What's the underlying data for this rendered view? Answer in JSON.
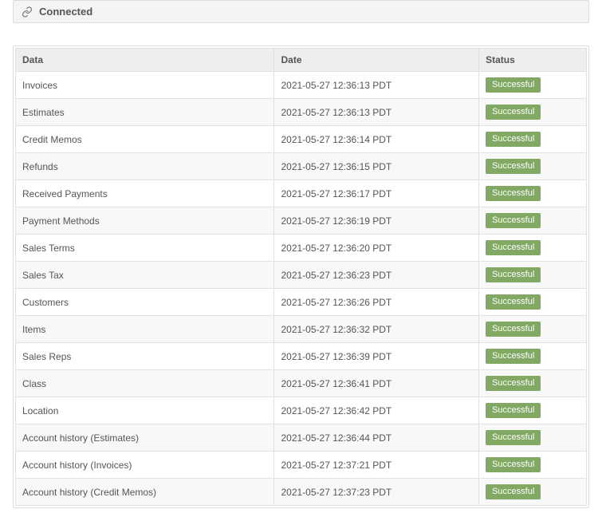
{
  "header": {
    "connected_label": "Connected",
    "icon_name": "link-icon"
  },
  "table": {
    "columns": {
      "data": "Data",
      "date": "Date",
      "status": "Status"
    },
    "status_badge_color": "#82a963",
    "rows": [
      {
        "data": "Invoices",
        "date": "2021-05-27 12:36:13 PDT",
        "status": "Successful"
      },
      {
        "data": "Estimates",
        "date": "2021-05-27 12:36:13 PDT",
        "status": "Successful"
      },
      {
        "data": "Credit Memos",
        "date": "2021-05-27 12:36:14 PDT",
        "status": "Successful"
      },
      {
        "data": "Refunds",
        "date": "2021-05-27 12:36:15 PDT",
        "status": "Successful"
      },
      {
        "data": "Received Payments",
        "date": "2021-05-27 12:36:17 PDT",
        "status": "Successful"
      },
      {
        "data": "Payment Methods",
        "date": "2021-05-27 12:36:19 PDT",
        "status": "Successful"
      },
      {
        "data": "Sales Terms",
        "date": "2021-05-27 12:36:20 PDT",
        "status": "Successful"
      },
      {
        "data": "Sales Tax",
        "date": "2021-05-27 12:36:23 PDT",
        "status": "Successful"
      },
      {
        "data": "Customers",
        "date": "2021-05-27 12:36:26 PDT",
        "status": "Successful"
      },
      {
        "data": "Items",
        "date": "2021-05-27 12:36:32 PDT",
        "status": "Successful"
      },
      {
        "data": "Sales Reps",
        "date": "2021-05-27 12:36:39 PDT",
        "status": "Successful"
      },
      {
        "data": "Class",
        "date": "2021-05-27 12:36:41 PDT",
        "status": "Successful"
      },
      {
        "data": "Location",
        "date": "2021-05-27 12:36:42 PDT",
        "status": "Successful"
      },
      {
        "data": "Account history (Estimates)",
        "date": "2021-05-27 12:36:44 PDT",
        "status": "Successful"
      },
      {
        "data": "Account history (Invoices)",
        "date": "2021-05-27 12:37:21 PDT",
        "status": "Successful"
      },
      {
        "data": "Account history (Credit Memos)",
        "date": "2021-05-27 12:37:23 PDT",
        "status": "Successful"
      }
    ]
  }
}
